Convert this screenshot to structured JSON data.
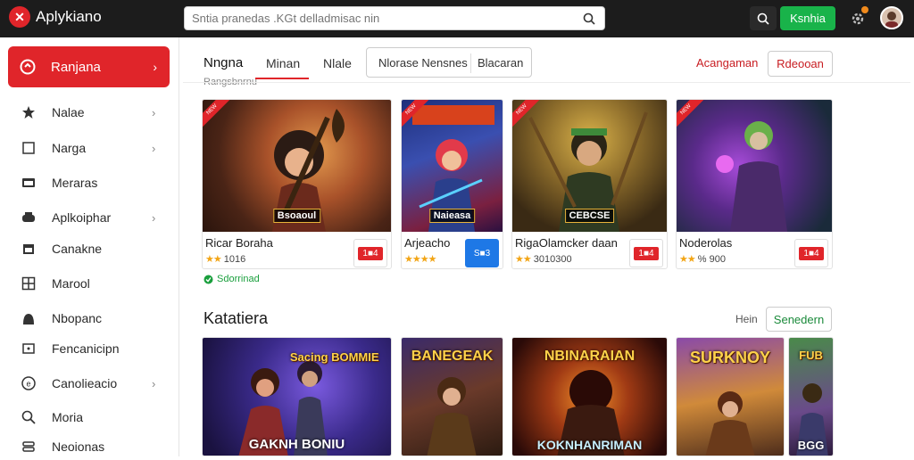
{
  "app": {
    "title": "Aplykiano"
  },
  "search": {
    "placeholder": "Sntia pranedas .KGt delladmisac nin"
  },
  "topbar": {
    "action_label": "Ksnhia"
  },
  "sidebar": {
    "active": {
      "label": "Ranjana",
      "arrow": "›"
    },
    "items": [
      {
        "label": "Nalae",
        "chevron": "›"
      },
      {
        "label": "Narga",
        "chevron": "›"
      },
      {
        "label": "Meraras",
        "chevron": ""
      },
      {
        "label": "Aplkoiphar",
        "chevron": "›"
      },
      {
        "label": "Canakne",
        "chevron": ""
      },
      {
        "label": "Marool",
        "chevron": ""
      },
      {
        "label": "Nbopanc",
        "chevron": ""
      },
      {
        "label": "Fencanicipn",
        "chevron": ""
      },
      {
        "label": "Canolieacio",
        "chevron": "›"
      },
      {
        "label": "Moria",
        "chevron": ""
      },
      {
        "label": "Neoionas",
        "chevron": ""
      }
    ]
  },
  "tabs": {
    "items": [
      "Nngna",
      "Minan",
      "Nlale"
    ],
    "box_left": "Nlorase Nensnes",
    "box_right": "Blacaran",
    "sublabel": "Rangsbnrnu"
  },
  "filters": {
    "link": "Acangaman",
    "button": "Rdeooan"
  },
  "featured": [
    {
      "name": "Ricar Boraha",
      "rating": "1016",
      "stars": "★★",
      "price": "1■4",
      "caption": "Bsoaoul",
      "ribbon": "NEW"
    },
    {
      "name": "Arjeacho",
      "rating": "",
      "stars": "★★★★",
      "price": "S■3",
      "caption": "Naieasa",
      "ribbon": "NEW",
      "blue": true
    },
    {
      "name": "RigaOlamcker daan",
      "rating": "3010300",
      "stars": "★★",
      "price": "1■4",
      "caption": "CEBCSE",
      "ribbon": "NEW"
    },
    {
      "name": "Noderolas",
      "rating": "% 900",
      "stars": "★★",
      "price": "1■4",
      "caption": "",
      "ribbon": "NEW"
    }
  ],
  "installed_label": "Sdorrinad",
  "section": {
    "title": "Katatiera",
    "link": "Hein",
    "button": "Senedern"
  },
  "row2": [
    {
      "top": "Sacing\nBOMMIE",
      "bottom": "GAKNH BONIU"
    },
    {
      "top": "BANEGEAK",
      "bottom": ""
    },
    {
      "top": "NBINARAIAN",
      "bottom": "KOKNHANRIMAN"
    },
    {
      "top": "SURKNOY",
      "bottom": ""
    },
    {
      "top": "FUB",
      "bottom": "BGG"
    }
  ],
  "colors": {
    "accent": "#e0252a",
    "green": "#19b34a",
    "topbar": "#1c1c1c"
  }
}
